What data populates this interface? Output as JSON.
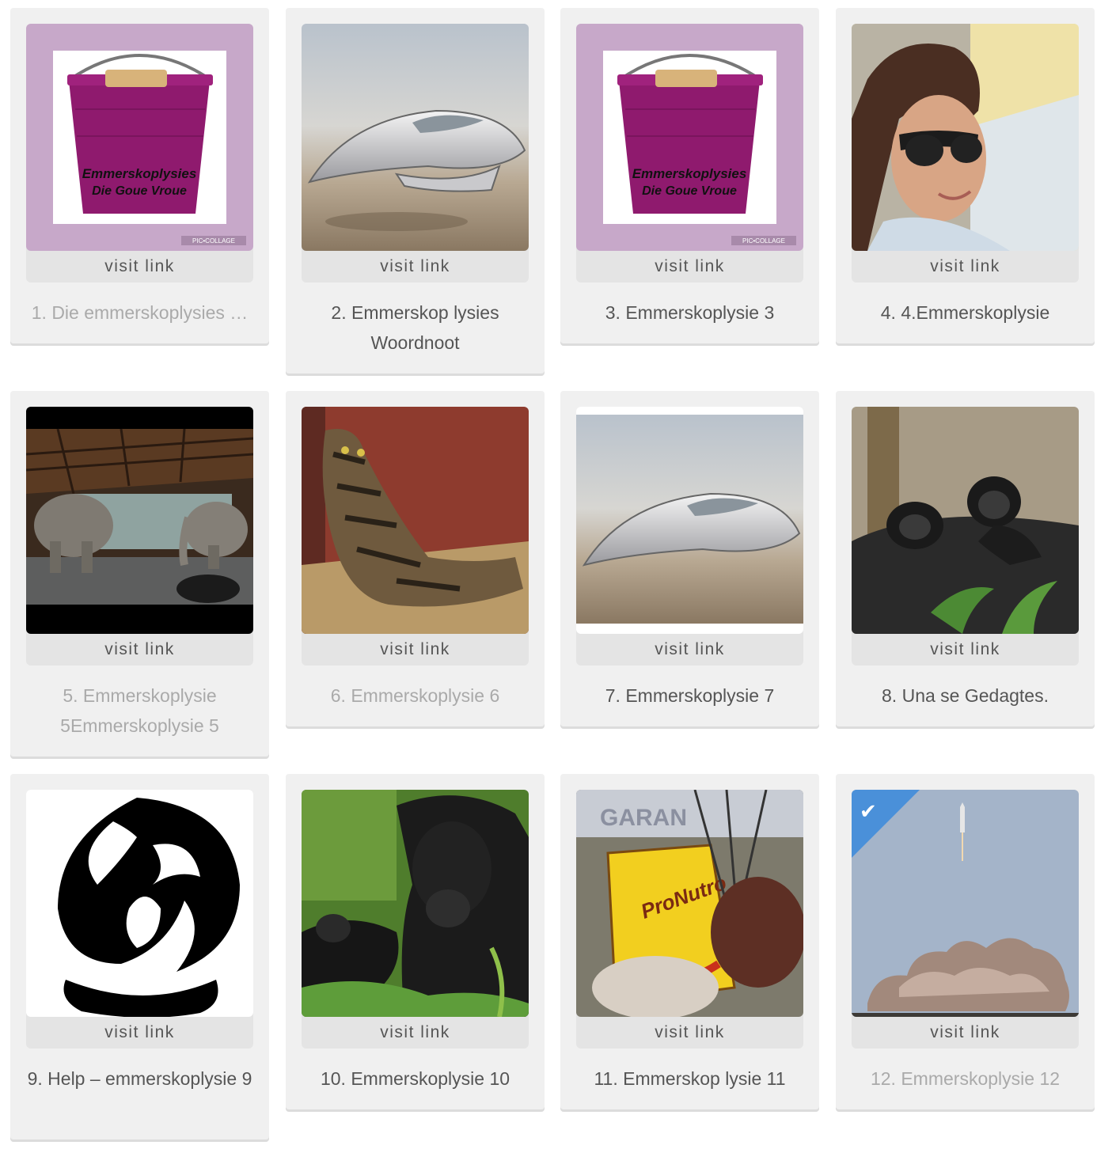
{
  "cards": [
    {
      "number": "1.",
      "title": "Die emmerskoplysies …",
      "visit": "visit link",
      "image": "purple-bucket"
    },
    {
      "number": "2.",
      "title": "Emmerskop lysies Woordnoot",
      "visit": "visit link",
      "image": "silver-spaceship"
    },
    {
      "number": "3.",
      "title": "Emmerskoplysie 3",
      "visit": "visit link",
      "image": "purple-bucket"
    },
    {
      "number": "4.",
      "title": "4.Emmerskoplysie",
      "visit": "visit link",
      "image": "woman-sunglasses"
    },
    {
      "number": "5.",
      "title": "Emmerskoplysie 5Emmerskoplysie 5",
      "visit": "visit link",
      "image": "elephants-lodge"
    },
    {
      "number": "6.",
      "title": "Emmerskoplysie 6",
      "visit": "visit link",
      "image": "tabby-cat"
    },
    {
      "number": "7.",
      "title": "Emmerskoplysie 7",
      "visit": "visit link",
      "image": "silver-spaceship"
    },
    {
      "number": "8.",
      "title": "Una se Gedagtes.",
      "visit": "visit link",
      "image": "baby-gorillas"
    },
    {
      "number": "9.",
      "title": "Help – emmerskoplysie 9",
      "visit": "visit link",
      "image": "black-flame-logo"
    },
    {
      "number": "10.",
      "title": "Emmerskoplysie 10",
      "visit": "visit link",
      "image": "gorilla-mother"
    },
    {
      "number": "11.",
      "title": "Emmerskop lysie 11",
      "visit": "visit link",
      "image": "prokutro-sign"
    },
    {
      "number": "12.",
      "title": "Emmerskoplysie 12",
      "visit": "visit link",
      "image": "rocket-launch"
    }
  ],
  "bucket": {
    "line1": "Emmerskoplysies",
    "line2": "Die Goue Vroue",
    "watermark": "PIC•COLLAGE"
  },
  "prokutro": {
    "label": "ProNutro",
    "sign": "GARAN"
  },
  "colors": {
    "accent": "#4a90d9",
    "card_bg": "#f0f0f0",
    "visit_bg": "#e4e4e4",
    "bucket_bg": "#c7a8c9",
    "bucket": "#8f1a6e"
  }
}
